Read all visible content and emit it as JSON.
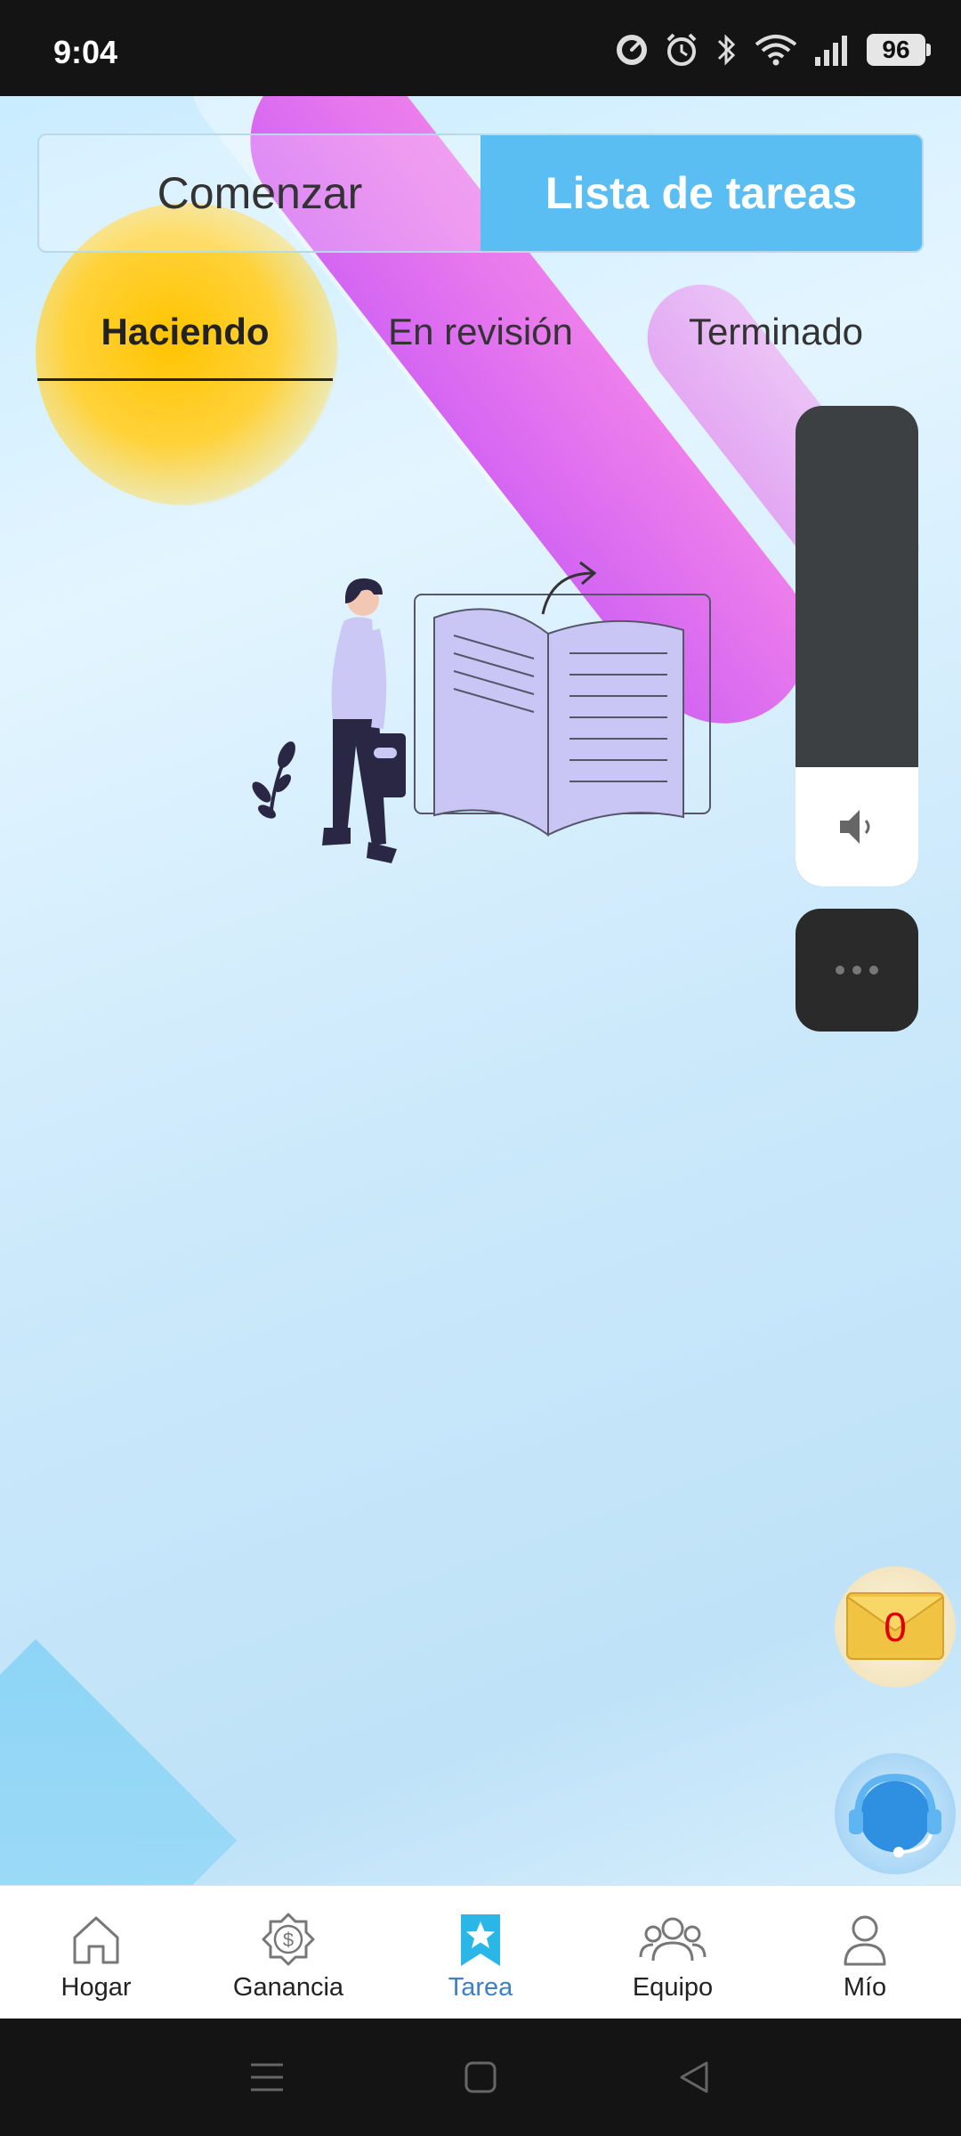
{
  "status_bar": {
    "time": "9:04",
    "battery": "96",
    "icons": [
      "speed-icon",
      "alarm-icon",
      "bluetooth-icon",
      "wifi-icon",
      "signal-icon",
      "battery-icon"
    ]
  },
  "segmented_control": {
    "items": [
      {
        "label": "Comenzar",
        "active": false
      },
      {
        "label": "Lista de tareas",
        "active": true
      }
    ]
  },
  "sub_tabs": {
    "items": [
      {
        "label": "Haciendo",
        "active": true
      },
      {
        "label": "En revisión",
        "active": false
      },
      {
        "label": "Terminado",
        "active": false
      }
    ]
  },
  "floating": {
    "mail_count": "0",
    "icons": [
      "volume-icon",
      "more-icon",
      "mail-icon",
      "headset-icon"
    ]
  },
  "bottom_nav": {
    "items": [
      {
        "label": "Hogar",
        "icon": "home-icon",
        "active": false
      },
      {
        "label": "Ganancia",
        "icon": "earnings-icon",
        "active": false
      },
      {
        "label": "Tarea",
        "icon": "task-star-icon",
        "active": true
      },
      {
        "label": "Equipo",
        "icon": "team-icon",
        "active": false
      },
      {
        "label": "Mío",
        "icon": "profile-icon",
        "active": false
      }
    ]
  },
  "colors": {
    "accent": "#5bbef2",
    "nav_active": "#3d7fc9",
    "illustration_purple": "#c9c6f5"
  }
}
